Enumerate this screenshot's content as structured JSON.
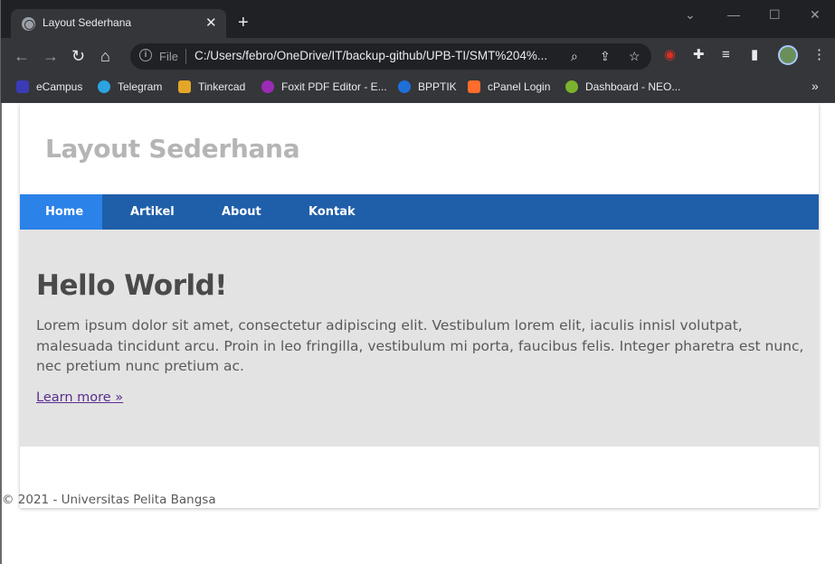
{
  "browser": {
    "tab_title": "Layout Sederhana",
    "tab_close": "✕",
    "new_tab": "+",
    "scheme_label": "File",
    "url": "C:/Users/febro/OneDrive/IT/backup-github/UPB-TI/SMT%204%...",
    "icons": [
      "back-icon",
      "forward-icon",
      "reload-icon",
      "home-icon",
      "info-icon",
      "zoom-icon",
      "share-icon",
      "star-icon",
      "extension-icon",
      "puzzle-icon",
      "media-icon",
      "sidepanel-icon",
      "profile-avatar",
      "menu-icon"
    ],
    "window_controls": {
      "chevron": "⌄",
      "minimize": "—",
      "maximize": "☐",
      "close": "✕"
    }
  },
  "bookmarks": [
    {
      "label": "eCampus",
      "color": "#3b3bb8"
    },
    {
      "label": "Telegram",
      "color": "#2aa3e0"
    },
    {
      "label": "Tinkercad",
      "color": "#e2a729"
    },
    {
      "label": "Foxit PDF Editor - E...",
      "color": "#9b2bb5"
    },
    {
      "label": "BPPTIK",
      "color": "#1f6fd9"
    },
    {
      "label": "cPanel Login",
      "color": "#ff6c2c"
    },
    {
      "label": "Dashboard - NEO...",
      "color": "#7bb32e"
    }
  ],
  "bookmarks_more": "»",
  "site": {
    "title": "Layout Sederhana",
    "nav": [
      "Home",
      "Artikel",
      "About",
      "Kontak"
    ],
    "hero_title": "Hello World!",
    "hero_text": "Lorem ipsum dolor sit amet, consectetur adipiscing elit. Vestibulum lorem elit, iaculis innisl volutpat, malesuada tincidunt arcu. Proin in leo fringilla, vestibulum mi porta, faucibus felis. Integer pharetra est nunc, nec pretium nunc pretium ac.",
    "learn_more": "Learn more »",
    "footer": "© 2021 - Universitas Pelita Bangsa"
  },
  "colors": {
    "nav_bg": "#1f5faa",
    "nav_active": "#2b83ea",
    "hero_bg": "#e3e3e3",
    "link": "#5b2d8e"
  }
}
